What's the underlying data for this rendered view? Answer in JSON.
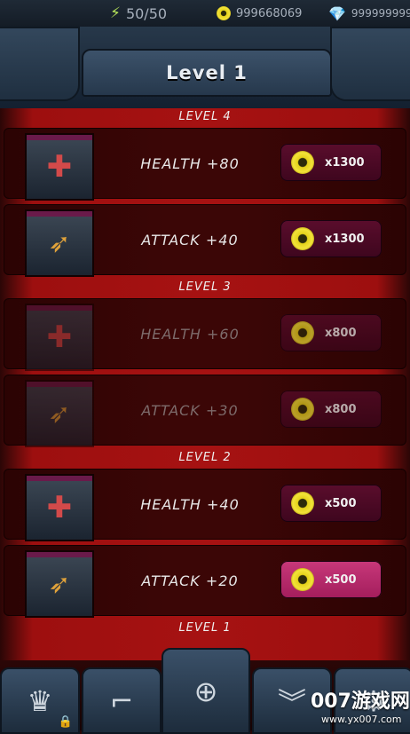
{
  "status": {
    "energy": "50/50",
    "coins": "999668069",
    "gems": "999999999"
  },
  "title": "Level 1",
  "levels": [
    {
      "label": "LEVEL 4",
      "items": [
        {
          "name": "HEALTH +80",
          "price": "x1300",
          "icon": "heart-shield-icon",
          "locked": false,
          "active": false
        },
        {
          "name": "ATTACK +40",
          "price": "x1300",
          "icon": "bullets-icon",
          "locked": false,
          "active": false
        }
      ]
    },
    {
      "label": "LEVEL 3",
      "items": [
        {
          "name": "HEALTH +60",
          "price": "x800",
          "icon": "heart-shield-icon",
          "locked": true,
          "active": false
        },
        {
          "name": "ATTACK +30",
          "price": "x800",
          "icon": "bullets-icon",
          "locked": true,
          "active": false
        }
      ]
    },
    {
      "label": "LEVEL 2",
      "items": [
        {
          "name": "HEALTH +40",
          "price": "x500",
          "icon": "heart-shield-icon",
          "locked": false,
          "active": false
        },
        {
          "name": "ATTACK +20",
          "price": "x500",
          "icon": "bullets-icon",
          "locked": false,
          "active": true
        }
      ]
    },
    {
      "label": "LEVEL 1",
      "items": []
    }
  ],
  "nav": [
    {
      "name": "crown-icon",
      "locked": true
    },
    {
      "name": "gun-icon",
      "locked": false
    },
    {
      "name": "crosshair-icon",
      "locked": false
    },
    {
      "name": "rank-chevron-icon",
      "locked": false
    },
    {
      "name": "settings-icon",
      "locked": false
    }
  ],
  "watermark": {
    "text": "007游戏网",
    "url": "www.yx007.com"
  },
  "colors": {
    "accent_active": "#c8387a",
    "button_inactive": "#5a0d2c",
    "coin": "#e4d21a",
    "gem": "#ff5cc2"
  }
}
